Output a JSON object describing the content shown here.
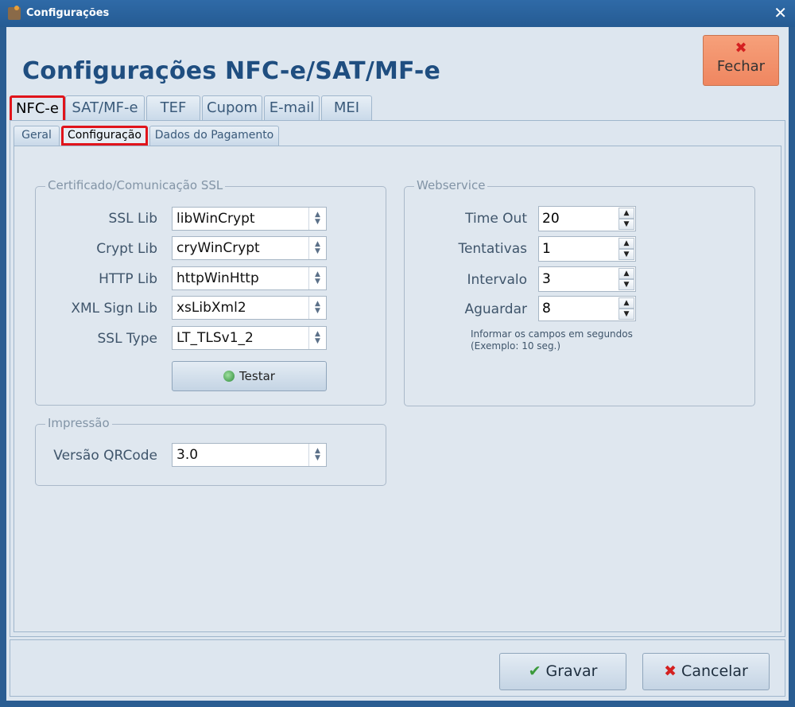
{
  "window": {
    "title": "Configurações",
    "app_icon": "app-icon",
    "close_glyph": "✕"
  },
  "header": {
    "title": "Configurações NFC-e/SAT/MF-e",
    "close_button": {
      "label": "Fechar",
      "icon": "close-icon",
      "glyph": "✖"
    }
  },
  "tabs": [
    {
      "label": "NFC-e",
      "active": true
    },
    {
      "label": "SAT/MF-e"
    },
    {
      "label": "TEF"
    },
    {
      "label": "Cupom"
    },
    {
      "label": "E-mail"
    },
    {
      "label": "MEI"
    }
  ],
  "subtabs": [
    {
      "label": "Geral"
    },
    {
      "label": "Configuração",
      "active": true
    },
    {
      "label": "Dados do Pagamento"
    }
  ],
  "ssl_group": {
    "legend": "Certificado/Comunicação SSL",
    "fields": [
      {
        "label": "SSL Lib",
        "value": "libWinCrypt"
      },
      {
        "label": "Crypt Lib",
        "value": "cryWinCrypt"
      },
      {
        "label": "HTTP Lib",
        "value": "httpWinHttp"
      },
      {
        "label": "XML Sign Lib",
        "value": "xsLibXml2"
      },
      {
        "label": "SSL Type",
        "value": "LT_TLSv1_2"
      }
    ],
    "test_button": {
      "label": "Testar",
      "icon": "test-icon"
    }
  },
  "print_group": {
    "legend": "Impressão",
    "fields": [
      {
        "label": "Versão QRCode",
        "value": "3.0"
      }
    ]
  },
  "webservice_group": {
    "legend": "Webservice",
    "fields": [
      {
        "label": "Time Out",
        "value": "20"
      },
      {
        "label": "Tentativas",
        "value": "1"
      },
      {
        "label": "Intervalo",
        "value": "3"
      },
      {
        "label": "Aguardar",
        "value": "8"
      }
    ],
    "hint_line1": "Informar os campos em segundos",
    "hint_line2": "(Exemplo: 10 seg.)"
  },
  "footer": {
    "save_button": {
      "label": "Gravar",
      "icon": "check-icon",
      "glyph": "✔"
    },
    "cancel_button": {
      "label": "Cancelar",
      "icon": "cancel-icon",
      "glyph": "✖"
    }
  },
  "colors": {
    "title_blue": "#1f4e80",
    "close_button_bg": "#f28e66",
    "highlight_red": "#e0141b"
  }
}
